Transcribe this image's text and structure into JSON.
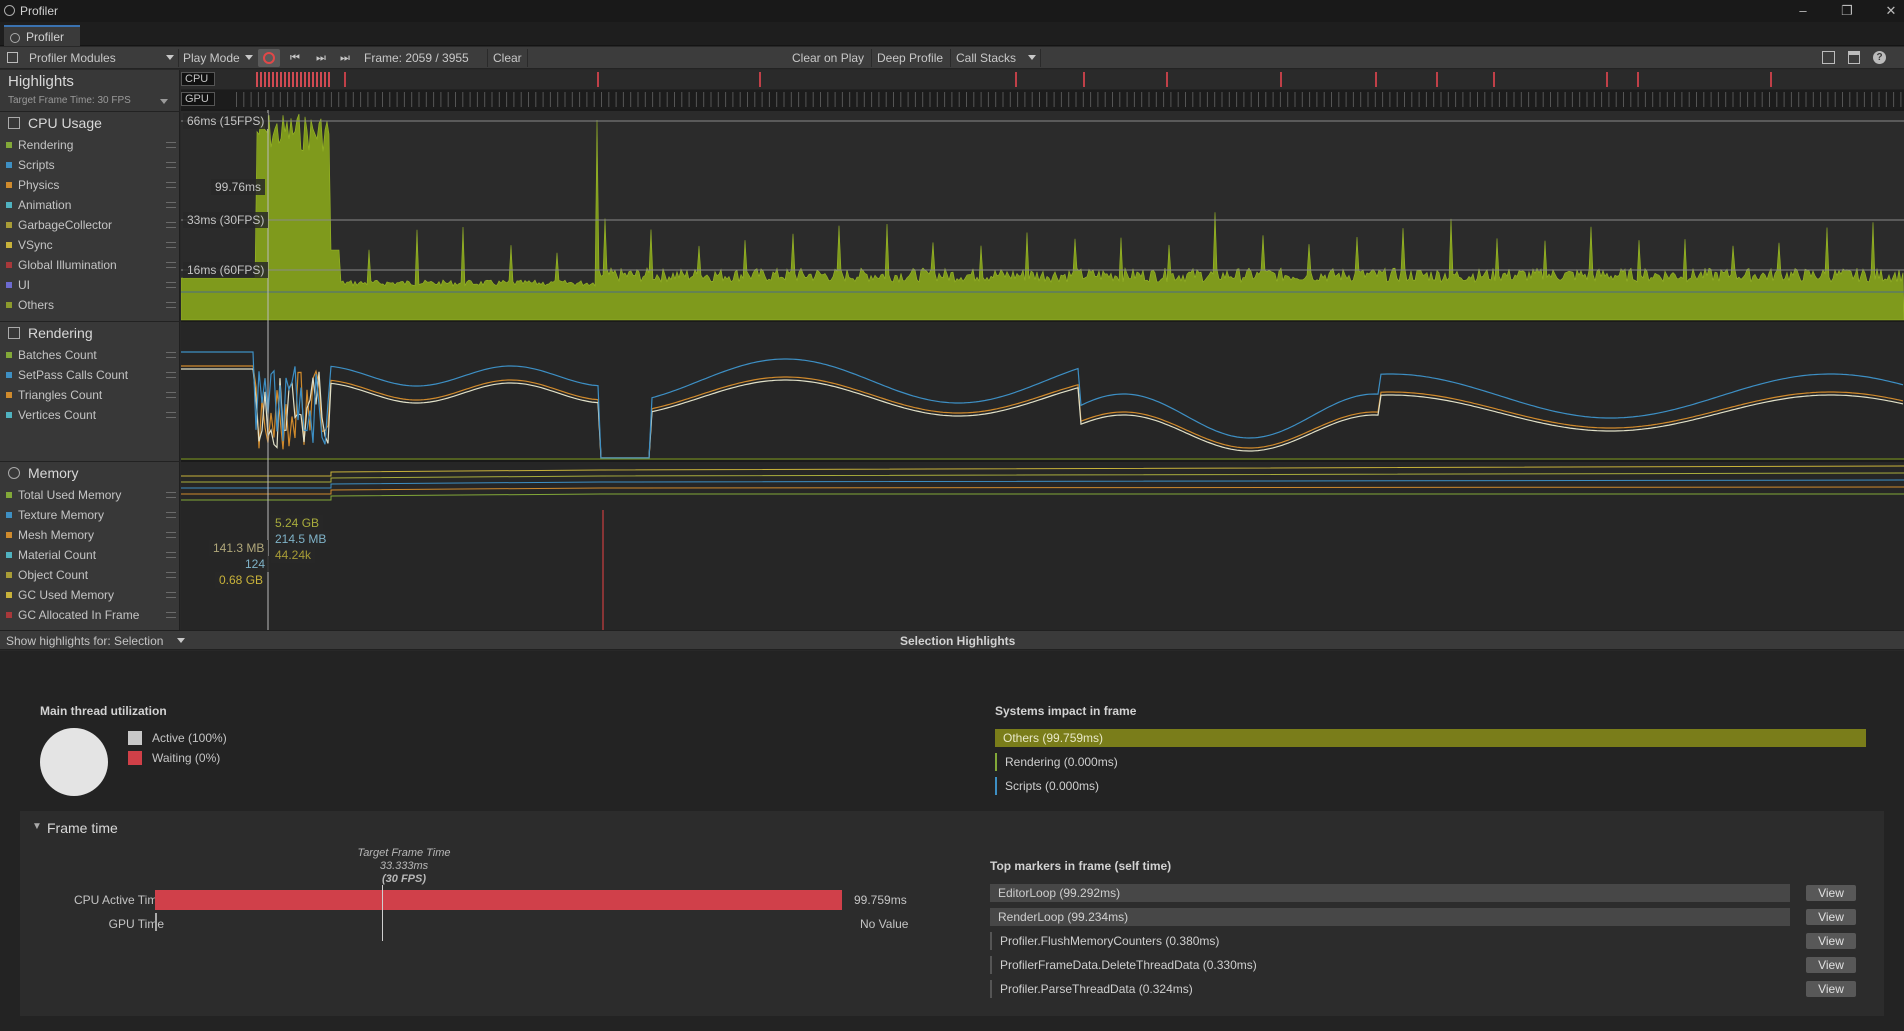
{
  "window": {
    "title": "Profiler",
    "tab": "Profiler"
  },
  "toolbar": {
    "modules": "Profiler Modules",
    "play_mode": "Play Mode",
    "frame": "Frame: 2059 / 3955",
    "clear": "Clear",
    "clear_on_play": "Clear on Play",
    "deep_profile": "Deep Profile",
    "call_stacks": "Call Stacks"
  },
  "highlights": {
    "title": "Highlights",
    "target": "Target Frame Time: 30 FPS",
    "cpu_label": "CPU",
    "gpu_label": "GPU"
  },
  "cpu_usage": {
    "title": "CPU Usage",
    "legend": [
      {
        "label": "Rendering",
        "color": "#82a838"
      },
      {
        "label": "Scripts",
        "color": "#3d8fc4"
      },
      {
        "label": "Physics",
        "color": "#d08a2c"
      },
      {
        "label": "Animation",
        "color": "#4fb2c0"
      },
      {
        "label": "GarbageCollector",
        "color": "#a89c36"
      },
      {
        "label": "VSync",
        "color": "#c8b23a"
      },
      {
        "label": "Global Illumination",
        "color": "#a8383a"
      },
      {
        "label": "UI",
        "color": "#6c6ad0"
      },
      {
        "label": "Others",
        "color": "#8c9a2c"
      }
    ],
    "gridlines": [
      "66ms (15FPS)",
      "33ms (30FPS)",
      "16ms (60FPS)"
    ],
    "selected_value": "99.76ms"
  },
  "rendering": {
    "title": "Rendering",
    "legend": [
      {
        "label": "Batches Count",
        "color": "#82a838"
      },
      {
        "label": "SetPass Calls Count",
        "color": "#3d8fc4"
      },
      {
        "label": "Triangles Count",
        "color": "#d08a2c"
      },
      {
        "label": "Vertices Count",
        "color": "#4fb2c0"
      }
    ]
  },
  "memory": {
    "title": "Memory",
    "legend": [
      {
        "label": "Total Used Memory",
        "color": "#82a838"
      },
      {
        "label": "Texture Memory",
        "color": "#3d8fc4"
      },
      {
        "label": "Mesh Memory",
        "color": "#d08a2c"
      },
      {
        "label": "Material Count",
        "color": "#4fb2c0"
      },
      {
        "label": "Object Count",
        "color": "#a89c36"
      },
      {
        "label": "GC Used Memory",
        "color": "#c8b23a"
      },
      {
        "label": "GC Allocated In Frame",
        "color": "#a8383a"
      }
    ],
    "values_left": [
      "141.3 MB",
      "124",
      "0.68 GB"
    ],
    "values_right": [
      "5.24 GB",
      "214.5 MB",
      "44.24k"
    ]
  },
  "highlights_bar": {
    "show_for": "Show highlights for: Selection",
    "title": "Selection Highlights"
  },
  "details": {
    "main_thread_title": "Main thread utilization",
    "active": "Active (100%)",
    "waiting": "Waiting (0%)",
    "systems_title": "Systems impact in frame",
    "systems": [
      "Others (99.759ms)",
      "Rendering (0.000ms)",
      "Scripts (0.000ms)"
    ],
    "frame_time_title": "Frame time",
    "target_title": "Target Frame Time",
    "target_ms": "33.333ms",
    "target_fps": "(30 FPS)",
    "cpu_active_label": "CPU Active Time",
    "cpu_active_value": "99.759ms",
    "gpu_label": "GPU Time",
    "gpu_value": "No Value",
    "top_markers_title": "Top markers in frame (self time)",
    "markers": [
      "EditorLoop (99.292ms)",
      "RenderLoop (99.234ms)",
      "Profiler.FlushMemoryCounters (0.380ms)",
      "ProfilerFrameData.DeleteThreadData (0.330ms)",
      "Profiler.ParseThreadData (0.324ms)"
    ],
    "view_label": "View"
  }
}
